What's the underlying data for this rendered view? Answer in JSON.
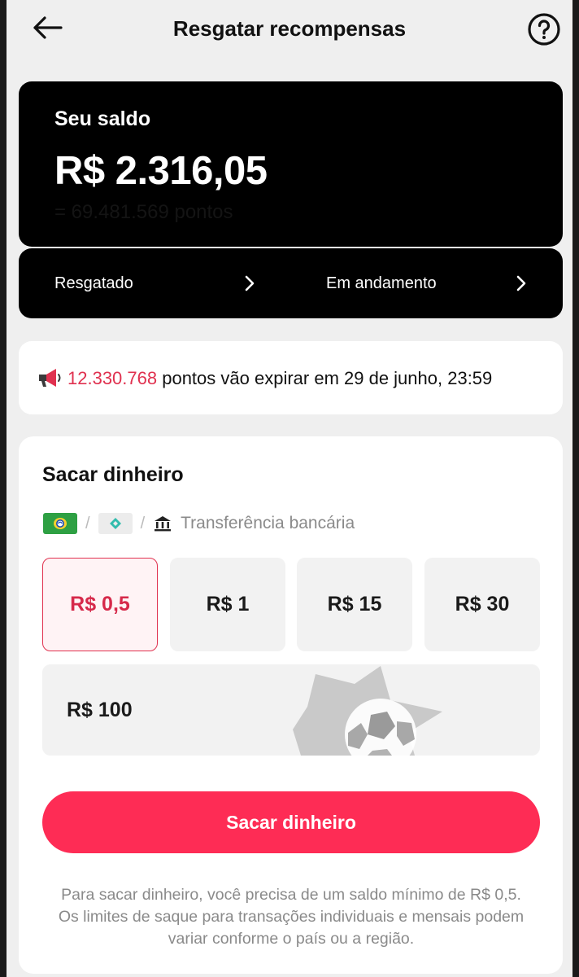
{
  "header": {
    "title": "Resgatar recompensas",
    "back_icon": "arrow-left-icon",
    "help_icon": "help-circle-icon"
  },
  "balance": {
    "label": "Seu saldo",
    "value": "R$ 2.316,05",
    "points": "= 69.481.569 pontos"
  },
  "status": {
    "redeemed_label": "Resgatado",
    "in_progress_label": "Em andamento"
  },
  "notice": {
    "icon": "megaphone-icon",
    "points": "12.330.768",
    "text": " pontos vão expirar em 29 de junho, 23:59"
  },
  "withdraw": {
    "title": "Sacar dinheiro",
    "methods": {
      "bank_label": "Transferência bancária"
    },
    "amounts": [
      "R$ 0,5",
      "R$ 1",
      "R$ 15",
      "R$ 30"
    ],
    "amount_wide": "R$ 100",
    "selected_index": 0,
    "button_label": "Sacar dinheiro",
    "note": "Para sacar dinheiro, você precisa de um saldo mínimo de R$ 0,5. Os limites de saque para transações individuais e mensais podem variar conforme o país ou a região."
  },
  "colors": {
    "accent": "#fe2c55",
    "points_highlight": "#e0314f",
    "card_dark": "#000000",
    "background": "#efefef"
  }
}
